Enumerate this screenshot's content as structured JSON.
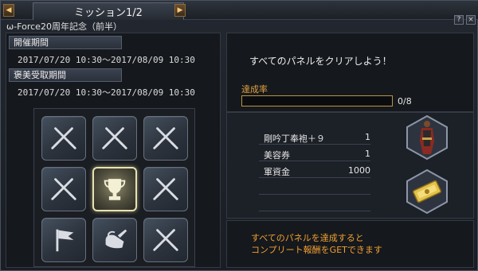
{
  "title": {
    "label": "ミッション1/2",
    "prev_icon": "triangle-left-icon",
    "next_icon": "triangle-right-icon"
  },
  "window_buttons": {
    "help": "?",
    "close": "×"
  },
  "subtitle": "ω-Force20周年記念（前半）",
  "periods": [
    {
      "label": "開催期間",
      "value": "2017/07/20 10:30～2017/08/09 10:30"
    },
    {
      "label": "褒美受取期間",
      "value": "2017/07/20 10:30～2017/08/09 10:30"
    }
  ],
  "panels": [
    {
      "icon": "crossed-swords-icon",
      "active": false
    },
    {
      "icon": "crossed-swords-icon",
      "active": false
    },
    {
      "icon": "crossed-swords-icon",
      "active": false
    },
    {
      "icon": "crossed-swords-icon",
      "active": false
    },
    {
      "icon": "trophy-icon",
      "active": true
    },
    {
      "icon": "crossed-swords-icon",
      "active": false
    },
    {
      "icon": "flag-icon",
      "active": false
    },
    {
      "icon": "watering-can-icon",
      "active": false
    },
    {
      "icon": "crossed-swords-icon",
      "active": false
    }
  ],
  "mission": {
    "text": "すべてのパネルをクリアしよう！",
    "rate_label": "達成率",
    "progress": 0,
    "progress_text": "0/8"
  },
  "rewards": [
    {
      "name": "剛吟丁奉袍＋９",
      "qty": "1"
    },
    {
      "name": "美容券",
      "qty": "1"
    },
    {
      "name": "軍資金",
      "qty": "1000"
    },
    {
      "name": "",
      "qty": ""
    },
    {
      "name": "",
      "qty": ""
    }
  ],
  "reward_icons": [
    "armor-costume-icon",
    "gold-ticket-icon"
  ],
  "complete": {
    "line1": "すべてのパネルを達成すると",
    "line2": "コンプリート報酬をGETできます"
  },
  "colors": {
    "accent_orange": "#f0a030",
    "progress_border": "#b89640",
    "active_tile_border": "#e8e2b0"
  }
}
